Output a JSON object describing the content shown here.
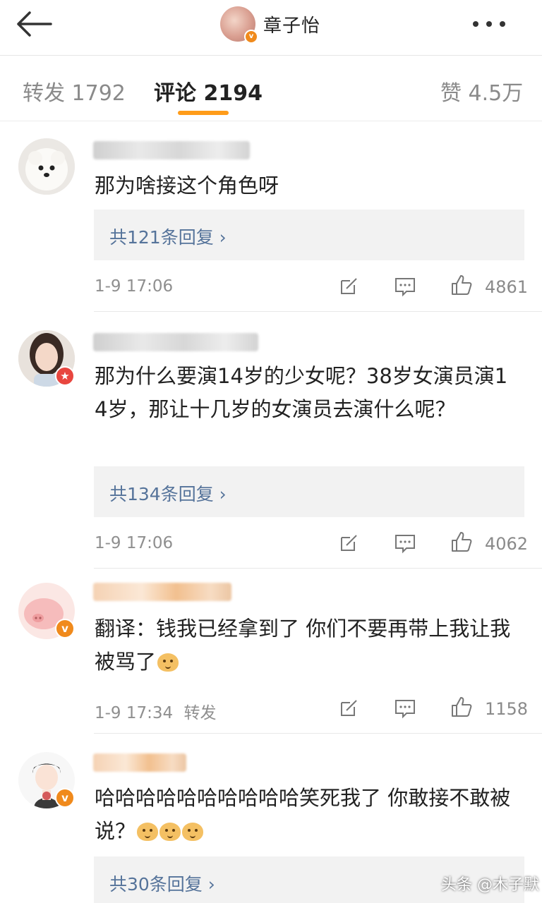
{
  "header": {
    "title": "章子怡",
    "back_icon": "arrow-left-icon",
    "more_icon": "more-dots-icon"
  },
  "tabs": [
    {
      "label": "转发 1792",
      "active": false
    },
    {
      "label": "评论 2194",
      "active": true
    },
    {
      "label": "赞 4.5万",
      "active": false
    }
  ],
  "accent_color": "#ff9c1a",
  "link_color": "#55739a",
  "comments": [
    {
      "text": "那为啥接这个角色呀",
      "reply_link": "共121条回复 ›",
      "time": "1-9 17:06",
      "likes": "4861"
    },
    {
      "text": "那为什么要演14岁的少女呢？38岁女演员演14岁，那让十几岁的女演员去演什么呢？",
      "reply_link": "共134条回复 ›",
      "time": "1-9 17:06",
      "likes": "4062"
    },
    {
      "text": "翻译：钱我已经拿到了 你们不要再带上我让我被骂了",
      "time": "1-9 17:34",
      "repost_label": "转发",
      "likes": "1158"
    },
    {
      "text": "哈哈哈哈哈哈哈哈哈哈笑死我了 你敢接不敢被说？",
      "reply_link": "共30条回复 ›"
    }
  ],
  "watermark": "头条 @木子默"
}
